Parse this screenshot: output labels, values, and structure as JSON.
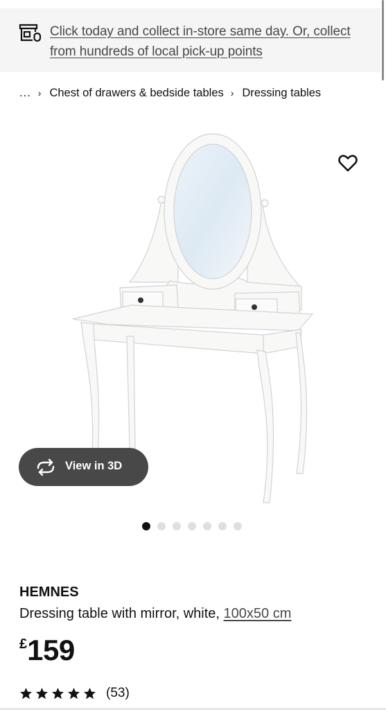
{
  "banner": {
    "text": "Click today and collect in-store same day. Or, collect from hundreds of local pick-up points",
    "icon": "store-icon"
  },
  "breadcrumb": {
    "ellipsis": "...",
    "items": [
      "Chest of drawers & bedside tables",
      "Dressing tables"
    ]
  },
  "gallery": {
    "view_3d_label": "View in 3D",
    "slide_count": 7,
    "active_slide": 1,
    "image_subject": "dressing table with oval mirror"
  },
  "product": {
    "brand": "HEMNES",
    "description": "Dressing table with mirror, white,",
    "dimensions": "100x50 cm",
    "currency": "£",
    "price": "159",
    "rating_stars": 5,
    "review_count": "(53)"
  },
  "colors": {
    "banner_bg": "#f5f5f5",
    "view3d_bg": "#484848",
    "active_dot": "#111111",
    "inactive_dot": "#dfdfdf"
  }
}
